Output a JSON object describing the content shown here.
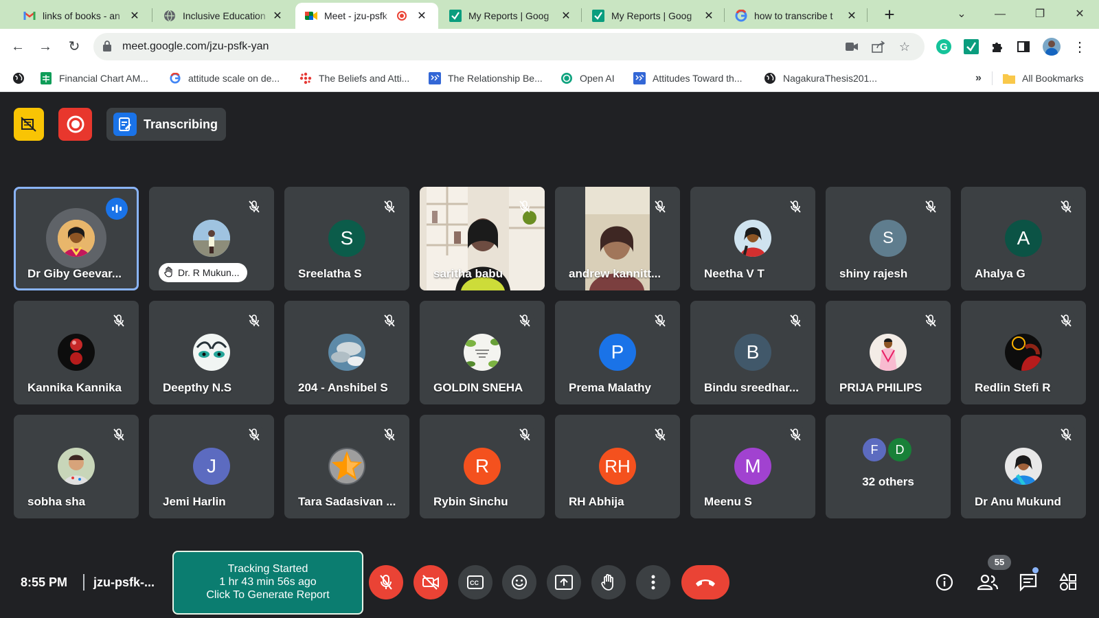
{
  "browser": {
    "tabs": [
      {
        "title": "links of books - an",
        "icon": "gmail-icon"
      },
      {
        "title": "Inclusive Education",
        "icon": "globe-icon"
      },
      {
        "title": "Meet - jzu-psfk",
        "icon": "meet-icon",
        "active": true,
        "recording": true
      },
      {
        "title": "My Reports | Goog",
        "icon": "check-icon"
      },
      {
        "title": "My Reports | Goog",
        "icon": "check-icon"
      },
      {
        "title": "how to transcribe t",
        "icon": "google-icon"
      }
    ],
    "new_tab": "+",
    "url": "meet.google.com/jzu-psfk-yan",
    "bookmarks": [
      {
        "label": "Financial Chart AM...",
        "icon": "sheets-icon"
      },
      {
        "label": "attitude scale on de...",
        "icon": "google-icon"
      },
      {
        "label": "The Beliefs and Atti...",
        "icon": "web-icon"
      },
      {
        "label": "The Relationship Be...",
        "icon": "doc-icon"
      },
      {
        "label": "Open AI",
        "icon": "openai-icon"
      },
      {
        "label": "Attitudes Toward th...",
        "icon": "doc-icon"
      },
      {
        "label": "NagakuraThesis201...",
        "icon": "globe-icon"
      }
    ],
    "bookmarks_overflow": "»",
    "all_bookmarks": "All Bookmarks"
  },
  "meet": {
    "transcribing_label": "Transcribing",
    "participants": [
      {
        "name": "Dr Giby Geevar...",
        "type": "photo",
        "speaking": true
      },
      {
        "name": "Dr. R Mukun...",
        "type": "photo",
        "hand_raised": true
      },
      {
        "name": "Sreelatha S",
        "type": "initial",
        "initial": "S",
        "color": "#0b5c4a"
      },
      {
        "name": "saritha babu",
        "type": "video"
      },
      {
        "name": "andrew kannitt...",
        "type": "video"
      },
      {
        "name": "Neetha V T",
        "type": "photo"
      },
      {
        "name": "shiny rajesh",
        "type": "initial",
        "initial": "S",
        "color": "#5f7d8e"
      },
      {
        "name": "Ahalya G",
        "type": "initial",
        "initial": "A",
        "color": "#0b5345"
      },
      {
        "name": "Kannika Kannika",
        "type": "photo"
      },
      {
        "name": "Deepthy N.S",
        "type": "photo"
      },
      {
        "name": "204 - Anshibel S",
        "type": "photo"
      },
      {
        "name": "GOLDIN SNEHA",
        "type": "photo"
      },
      {
        "name": "Prema Malathy",
        "type": "initial",
        "initial": "P",
        "color": "#1a73e8"
      },
      {
        "name": "Bindu sreedhar...",
        "type": "initial",
        "initial": "B",
        "color": "#41586a"
      },
      {
        "name": "PRIJA PHILIPS",
        "type": "photo"
      },
      {
        "name": "Redlin Stefi R",
        "type": "photo"
      },
      {
        "name": "sobha sha",
        "type": "photo"
      },
      {
        "name": "Jemi Harlin",
        "type": "initial",
        "initial": "J",
        "color": "#5c6bc0"
      },
      {
        "name": "Tara Sadasivan ...",
        "type": "photo"
      },
      {
        "name": "Rybin Sinchu",
        "type": "initial",
        "initial": "R",
        "color": "#f4511e"
      },
      {
        "name": "RH Abhija",
        "type": "initial",
        "initial": "RH",
        "color": "#f4511e"
      },
      {
        "name": "Meenu S",
        "type": "initial",
        "initial": "M",
        "color": "#a142d0"
      },
      {
        "name": "32 others",
        "type": "others",
        "avatars": [
          {
            "initial": "F",
            "color": "#5c6bc0"
          },
          {
            "initial": "D",
            "color": "#188038"
          }
        ]
      },
      {
        "name": "Dr Anu Mukund",
        "type": "photo"
      }
    ],
    "time": "8:55 PM",
    "meeting_code": "jzu-psfk-...",
    "tracker": {
      "line1": "Tracking Started",
      "line2": "1 hr 43 min 56s ago",
      "line3": "Click To Generate Report"
    },
    "participant_count": "55"
  }
}
